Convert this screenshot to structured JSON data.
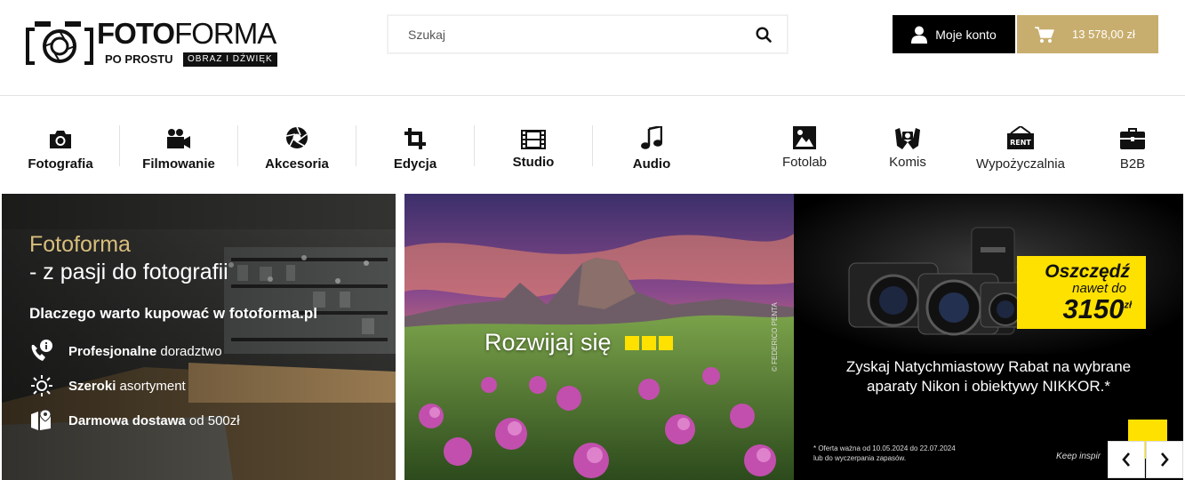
{
  "logo": {
    "brand": "FOTOFORMA",
    "word_bold": "FOTO",
    "word_light": "FORMA",
    "tagline_left": "PO PROSTU",
    "tagline_right": "OBRAZ I DŹWIĘK"
  },
  "search": {
    "placeholder": "Szukaj",
    "value": ""
  },
  "account": {
    "label": "Moje konto"
  },
  "cart": {
    "total": "13 578,00 zł"
  },
  "nav": {
    "items": [
      {
        "label": "Fotografia",
        "icon": "camera-icon"
      },
      {
        "label": "Filmowanie",
        "icon": "video-camera-icon"
      },
      {
        "label": "Akcesoria",
        "icon": "aperture-icon"
      },
      {
        "label": "Edycja",
        "icon": "crop-icon"
      },
      {
        "label": "Studio",
        "icon": "film-strip-icon"
      },
      {
        "label": "Audio",
        "icon": "music-note-icon"
      },
      {
        "label": "Fotolab",
        "icon": "photo-frame-icon"
      },
      {
        "label": "Komis",
        "icon": "hands-camera-icon"
      },
      {
        "label": "Wypożyczalnia",
        "icon": "rent-sign-icon"
      },
      {
        "label": "B2B",
        "icon": "briefcase-icon"
      }
    ]
  },
  "banner1": {
    "title1": "Fotoforma",
    "title2": "- z pasji do fotografii",
    "why": "Dlaczego warto kupować w fotoforma.pl",
    "features": [
      {
        "bold": "Profesjonalne",
        "rest": " doradztwo",
        "icon": "phone-info-icon"
      },
      {
        "bold": "Szeroki",
        "rest": " asortyment",
        "icon": "sparkle-icon"
      },
      {
        "bold": "Darmowa dostawa",
        "rest": " od 500zł",
        "icon": "delivery-box-icon"
      }
    ]
  },
  "banner2": {
    "headline": "Rozwijaj się",
    "credit": "© FEDERICO PENTA"
  },
  "banner3": {
    "badge_l1": "Oszczędź",
    "badge_l2": "nawet do",
    "badge_l3": "3150",
    "badge_unit": "zł",
    "promo_line1": "Zyskaj Natychmiastowy Rabat na wybrane",
    "promo_line2": "aparaty Nikon i obiektywy NIKKOR.*",
    "note_line1": "* Oferta ważna od 10.05.2024 do 22.07.2024",
    "note_line2": "lub do wyczerpania zapasów.",
    "keep": "Keep inspir"
  },
  "colors": {
    "accent_gold": "#c8ae6e",
    "title_gold": "#d8be7c",
    "yellow": "#ffe100",
    "dark": "#000000"
  }
}
